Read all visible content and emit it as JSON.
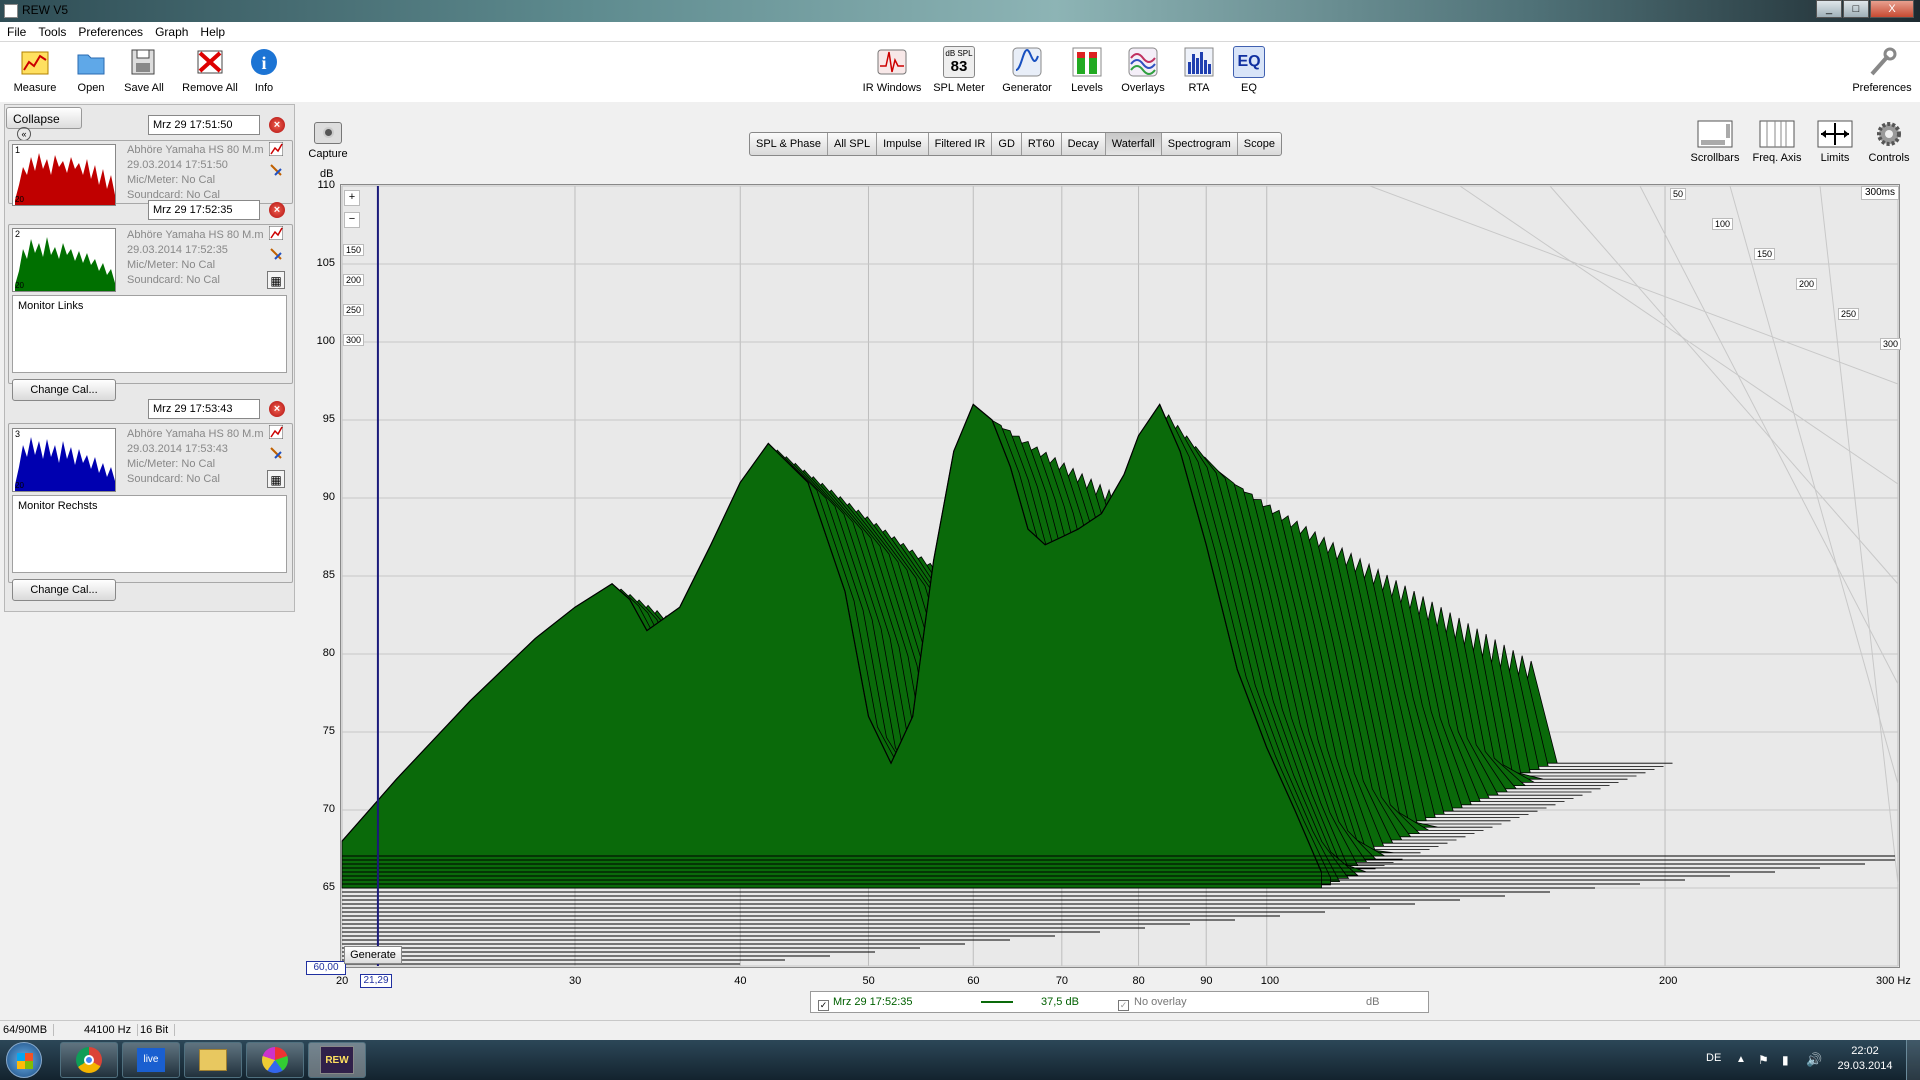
{
  "window": {
    "title": "REW V5",
    "buttons": [
      "_",
      "□",
      "X"
    ]
  },
  "menu": [
    "File",
    "Tools",
    "Preferences",
    "Graph",
    "Help"
  ],
  "toolbar_left": [
    {
      "label": "Measure",
      "icon": "measure-icon"
    },
    {
      "label": "Open",
      "icon": "folder-icon"
    },
    {
      "label": "Save All",
      "icon": "save-icon"
    },
    {
      "label": "Remove All",
      "icon": "remove-icon"
    },
    {
      "label": "Info",
      "icon": "info-icon"
    }
  ],
  "toolbar_center": [
    {
      "label": "IR Windows",
      "icon": "ir-windows-icon"
    },
    {
      "label": "SPL Meter",
      "icon": "spl-meter-icon",
      "top": "dB SPL",
      "value": "83"
    },
    {
      "label": "Generator",
      "icon": "generator-icon"
    },
    {
      "label": "Levels",
      "icon": "levels-icon"
    },
    {
      "label": "Overlays",
      "icon": "overlays-icon"
    },
    {
      "label": "RTA",
      "icon": "rta-icon"
    },
    {
      "label": "EQ",
      "icon": "eq-icon",
      "text": "EQ"
    }
  ],
  "preferences_label": "Preferences",
  "capture_label": "Capture",
  "collapse_label": "Collapse",
  "measurements": [
    {
      "number": "1",
      "name": "Mrz 29 17:51:50",
      "line1": "Abhöre Yamaha HS 80 M.m",
      "line2": "29.03.2014 17:51:50",
      "line3": "Mic/Meter: No Cal",
      "line4": "Soundcard: No Cal",
      "color": "#c00000"
    },
    {
      "number": "2",
      "name": "Mrz 29 17:52:35",
      "line1": "Abhöre Yamaha HS 80 M.m",
      "line2": "29.03.2014 17:52:35",
      "line3": "Mic/Meter: No Cal",
      "line4": "Soundcard: No Cal",
      "notes": "Monitor Links",
      "change_cal": "Change Cal...",
      "color": "#007000"
    },
    {
      "number": "3",
      "name": "Mrz 29 17:53:43",
      "line1": "Abhöre Yamaha HS 80 M.m",
      "line2": "29.03.2014 17:53:43",
      "line3": "Mic/Meter: No Cal",
      "line4": "Soundcard: No Cal",
      "notes": "Monitor Rechsts",
      "change_cal": "Change Cal...",
      "color": "#0000b0"
    }
  ],
  "thumb_label": "20",
  "graph_tabs": [
    "SPL & Phase",
    "All SPL",
    "Impulse",
    "Filtered IR",
    "GD",
    "RT60",
    "Decay",
    "Waterfall",
    "Spectrogram",
    "Scope"
  ],
  "active_tab": "Waterfall",
  "right_tools": [
    {
      "label": "Scrollbars",
      "icon": "scrollbars-icon"
    },
    {
      "label": "Freq. Axis",
      "icon": "freq-axis-icon"
    },
    {
      "label": "Limits",
      "icon": "limits-icon"
    },
    {
      "label": "Controls",
      "icon": "controls-icon"
    }
  ],
  "chart_data": {
    "type": "area",
    "title": "",
    "ylabel": "dB",
    "xlabel": "",
    "ylim": [
      60,
      110
    ],
    "xlim": [
      20,
      300
    ],
    "x_scale": "log",
    "y_ticks": [
      "110",
      "105",
      "100",
      "95",
      "90",
      "85",
      "80",
      "75",
      "70",
      "65"
    ],
    "x_ticks": [
      "20",
      "30",
      "40",
      "50",
      "60",
      "70",
      "80",
      "90",
      "100",
      "200",
      "300 Hz"
    ],
    "time_ticks": [
      "50",
      "100",
      "150",
      "200",
      "250",
      "300"
    ],
    "time_max_label": "300ms",
    "left_time_ticks": [
      "150",
      "200",
      "250",
      "300"
    ],
    "y_min_readout": "60,00",
    "x_cursor_readout": "21,29",
    "fill_color": "#0a6a0a",
    "front_slice": {
      "freq": [
        20,
        22,
        25,
        28,
        30,
        32,
        33,
        34,
        36,
        38,
        40,
        42,
        45,
        48,
        50,
        52,
        54,
        56,
        58,
        60,
        62,
        64,
        66,
        68,
        70,
        72,
        75,
        78,
        80,
        83,
        86,
        90,
        95,
        100,
        105,
        110
      ],
      "db": [
        68,
        72,
        77,
        81,
        83,
        84.5,
        83.5,
        81.5,
        83,
        87,
        91,
        93.5,
        91,
        84,
        76,
        73,
        76,
        86,
        93,
        96,
        95,
        92,
        88,
        87,
        87.5,
        88,
        89,
        91.5,
        94,
        96,
        93,
        87,
        79,
        74,
        70,
        66
      ]
    }
  },
  "generate_label": "Generate",
  "legend": {
    "name": "Mrz 29 17:52:35",
    "value": "37,5 dB",
    "overlay": "No overlay",
    "unit": "dB"
  },
  "status": {
    "memory": "64/90MB",
    "rate": "44100 Hz",
    "bits": "16 Bit"
  },
  "taskbar": {
    "lang": "DE",
    "time": "22:02",
    "date": "29.03.2014",
    "live_label": "live",
    "rew_label": "REW"
  }
}
